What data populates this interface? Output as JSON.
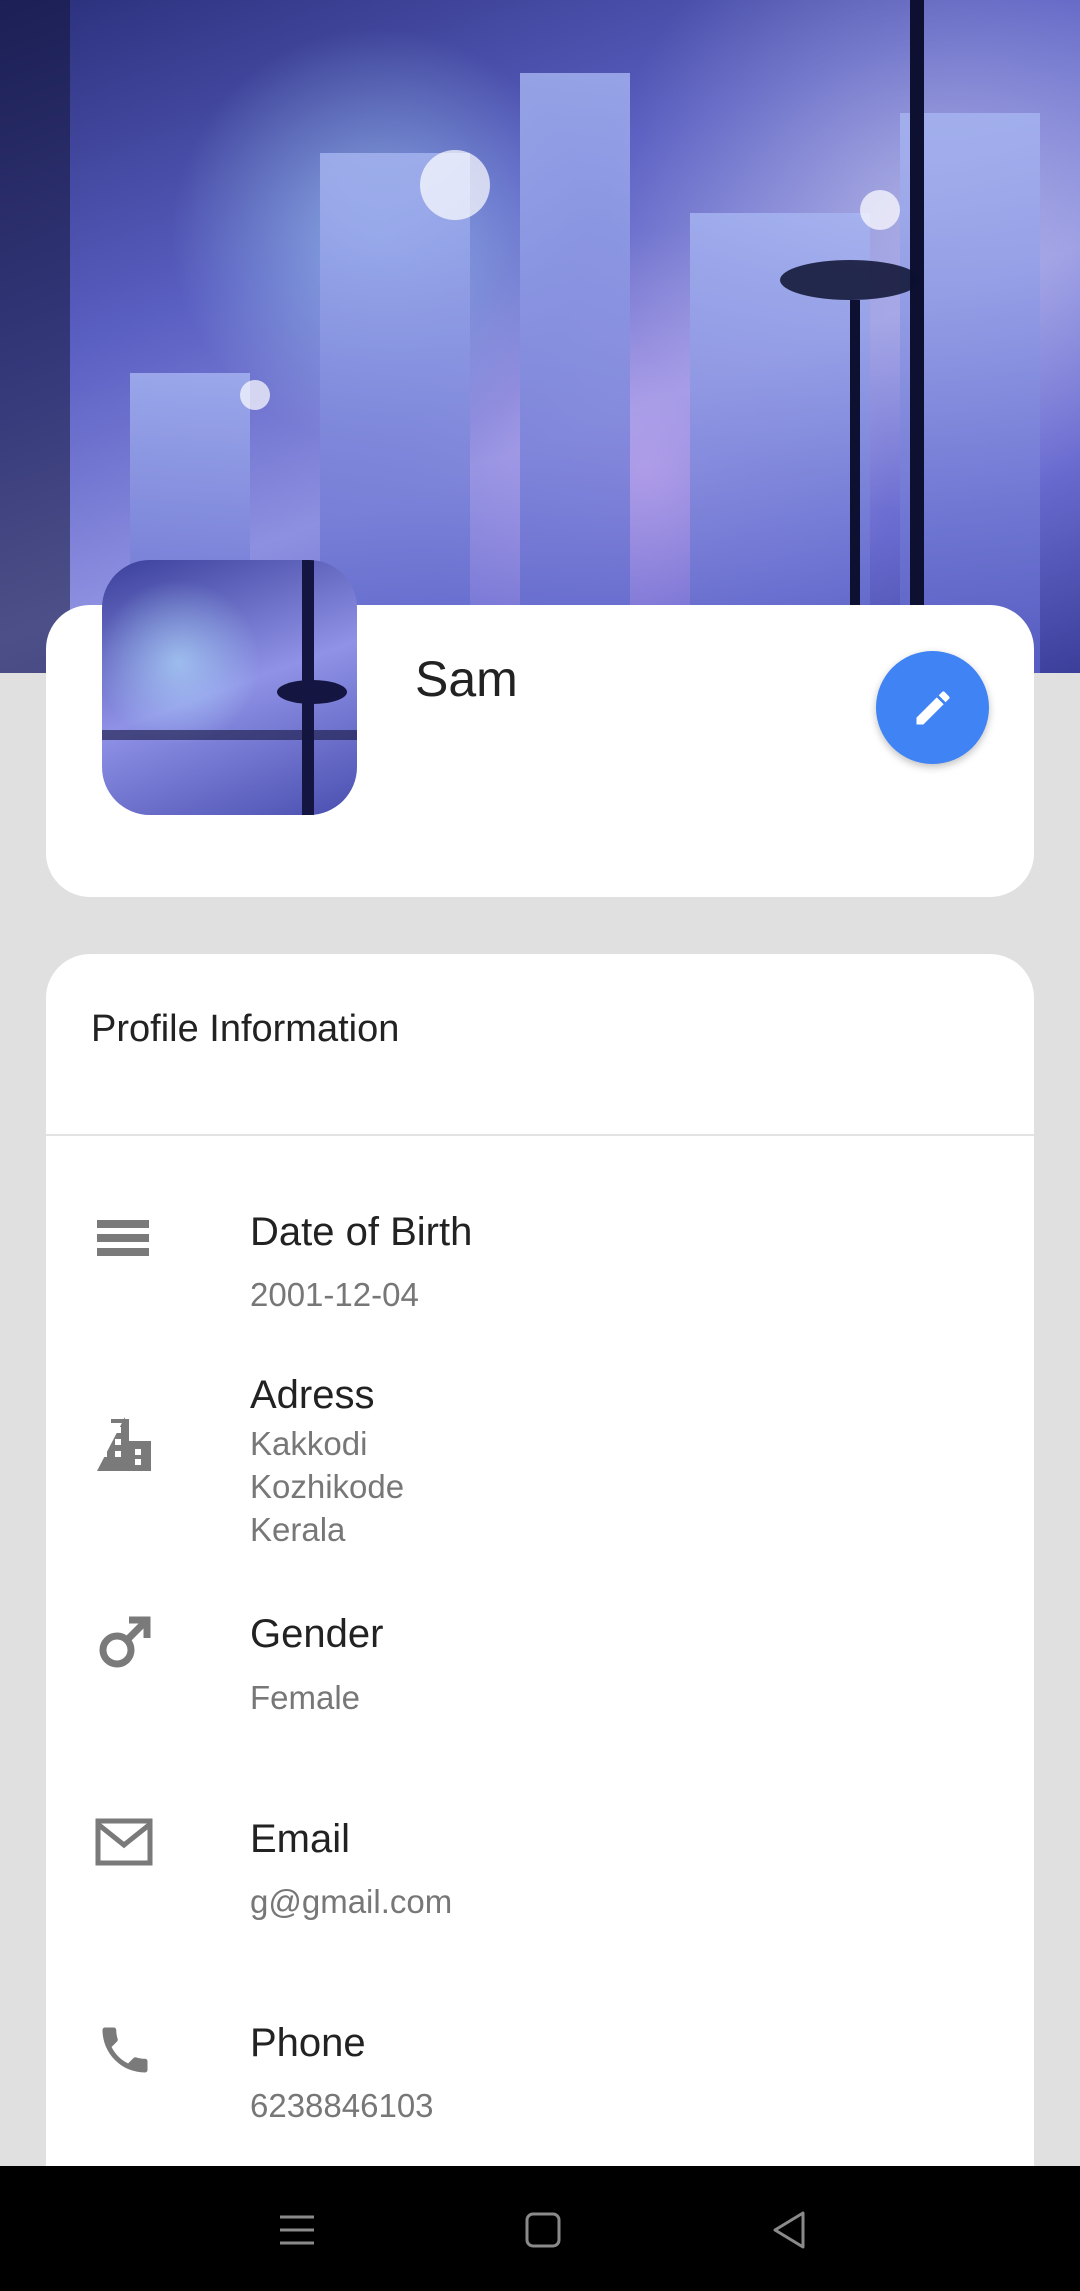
{
  "profile": {
    "name": "Sam"
  },
  "section": {
    "title": "Profile Information"
  },
  "rows": [
    {
      "label": "Date of Birth",
      "value": "2001-12-04",
      "icon": "calendar-icon"
    },
    {
      "label": "Adress",
      "value_lines": [
        "Kakkodi",
        "Kozhikode",
        "Kerala"
      ],
      "icon": "building-icon"
    },
    {
      "label": "Gender",
      "value": "Female",
      "icon": "male-icon"
    },
    {
      "label": "Email",
      "value": "g@gmail.com",
      "icon": "mail-icon"
    },
    {
      "label": "Phone",
      "value": "6238846103",
      "icon": "phone-icon"
    }
  ],
  "colors": {
    "fab": "#3f83f4",
    "icon": "#7a7a7a"
  },
  "nav": {
    "icons": [
      "menu-icon",
      "home-icon",
      "back-icon"
    ]
  }
}
